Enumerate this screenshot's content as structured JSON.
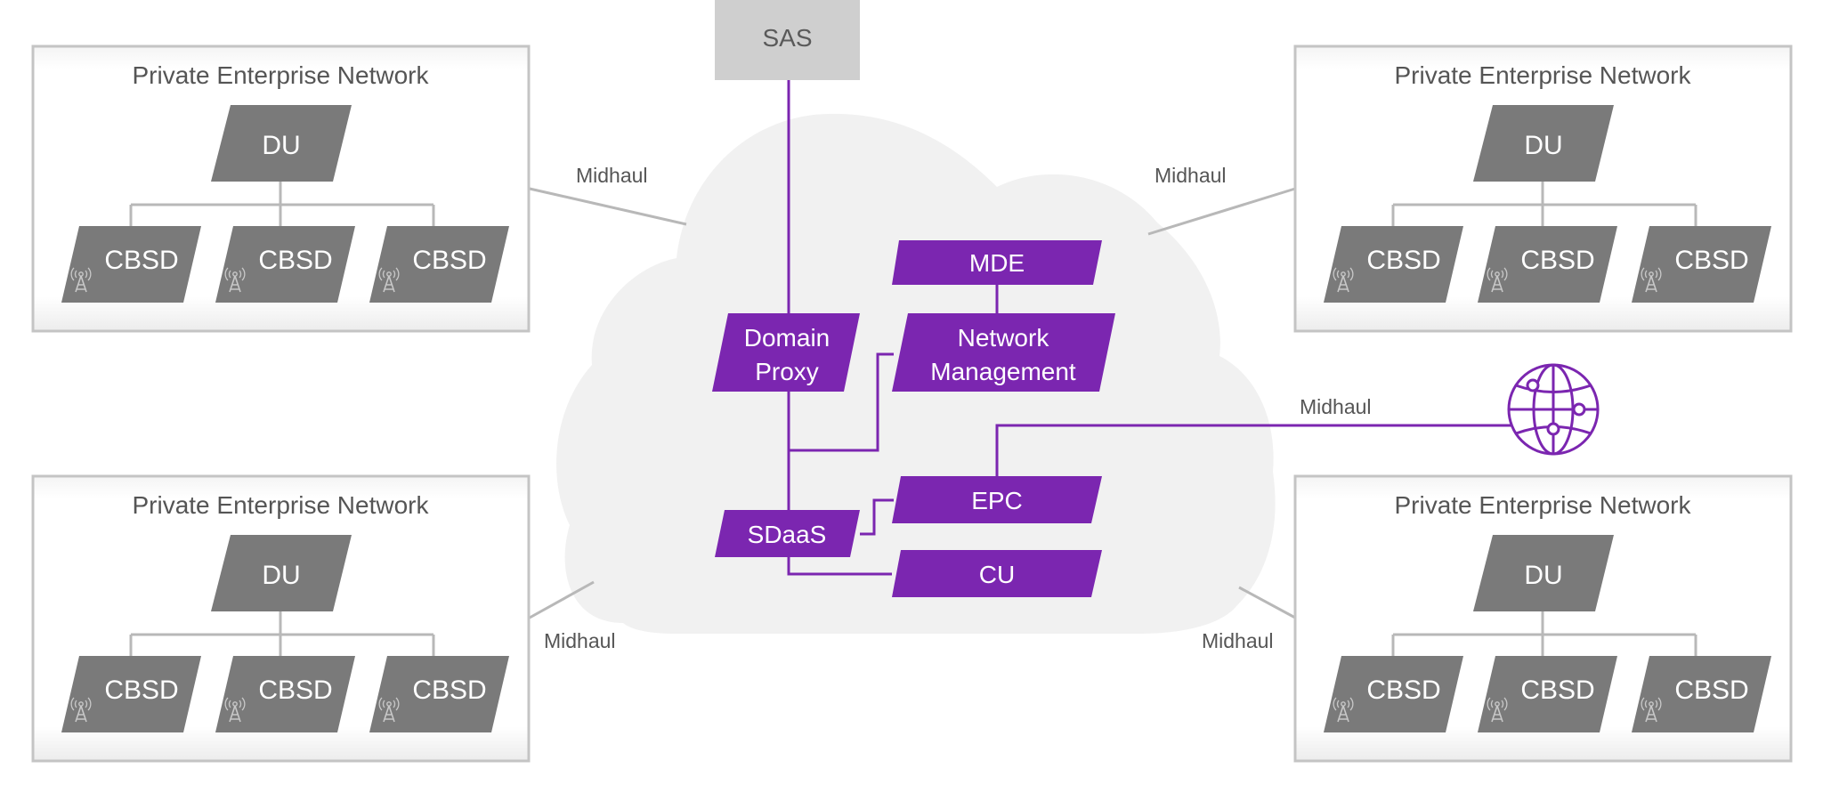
{
  "colors": {
    "purple": "#7b26b0",
    "gray_node": "#7a7a7a",
    "gray_line": "#b8b8b8",
    "cloud": "#f1f1f1",
    "sas_fill": "#cfcfcf",
    "box_border": "#c4c4c4"
  },
  "sas": {
    "label": "SAS"
  },
  "networks": [
    {
      "title": "Private Enterprise Network",
      "du": "DU",
      "cbsds": [
        "CBSD",
        "CBSD",
        "CBSD"
      ]
    },
    {
      "title": "Private Enterprise Network",
      "du": "DU",
      "cbsds": [
        "CBSD",
        "CBSD",
        "CBSD"
      ]
    },
    {
      "title": "Private Enterprise Network",
      "du": "DU",
      "cbsds": [
        "CBSD",
        "CBSD",
        "CBSD"
      ]
    },
    {
      "title": "Private Enterprise Network",
      "du": "DU",
      "cbsds": [
        "CBSD",
        "CBSD",
        "CBSD"
      ]
    }
  ],
  "cloud_nodes": {
    "domain_proxy": [
      "Domain",
      "Proxy"
    ],
    "mde": "MDE",
    "network_management": [
      "Network",
      "Management"
    ],
    "sdaas": "SDaaS",
    "epc": "EPC",
    "cu": "CU"
  },
  "links": {
    "midhaul_top_left": "Midhaul",
    "midhaul_top_right": "Midhaul",
    "midhaul_bottom_left": "Midhaul",
    "midhaul_bottom_right": "Midhaul",
    "midhaul_internet": "Midhaul"
  },
  "icons": {
    "cbsd": "antenna-tower-icon",
    "internet": "globe-network-icon"
  }
}
